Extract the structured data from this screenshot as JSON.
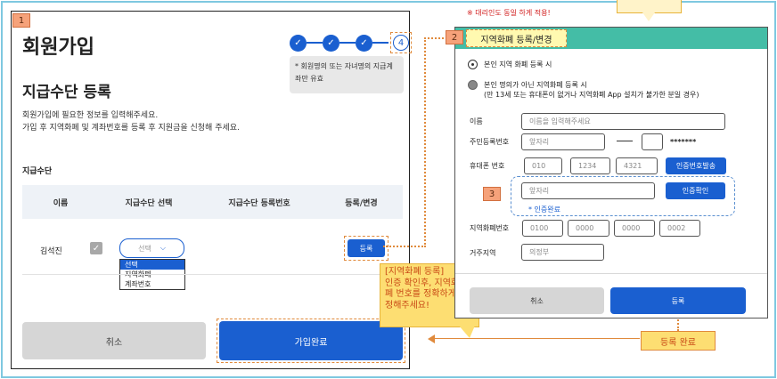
{
  "step_badges": {
    "left": "1",
    "right": "2",
    "verify": "3"
  },
  "left_panel": {
    "title": "회원가입",
    "steps": [
      "✓",
      "✓",
      "✓",
      "4"
    ],
    "notice": "* 회원명의 또는 자녀명의 지급계좌만 유효",
    "subtitle": "지급수단 등록",
    "desc_line1": "회원가입에 필요한 정보를 입력해주세요.",
    "desc_line2": "가입 후 지역화폐 및 계좌번호를 등록 후 지원금을 신청해 주세요.",
    "section_label": "지급수단",
    "table_headers": [
      "이름",
      "지급수단 선택",
      "지급수단 등록번호",
      "등록/변경"
    ],
    "row": {
      "name": "김석진",
      "checkbox_mark": "✓",
      "select_value": "선택",
      "select_arrow": "⌵",
      "dropdown_options": [
        "선택",
        "지역화폐",
        "계좌번호"
      ],
      "register_button": "등록"
    },
    "cancel_button": "취소",
    "join_button": "가입완료"
  },
  "callout": {
    "line1": "[지역화폐 등록]",
    "line2": "인증 확인후, 지역화",
    "line3": "폐 번호를 정확하게",
    "line4": "정해주세요!"
  },
  "right_panel": {
    "top_note": "※ 대리인도 동일 하게 적용!",
    "header_title": "지역화폐 등록/변경",
    "radio1_label": "본인 지역 화폐 등록 시",
    "radio2_label_line1": "본인 명의가 아닌 지역화폐 등록 시",
    "radio2_label_line2": "(만 13세 또는 휴대폰이 없거나 지역화폐 App 설치가 불가한 분일 경우)",
    "name_label": "이름",
    "name_placeholder": "이름을 입력해주세요",
    "rrn_label": "주민등록번호",
    "rrn_placeholder": "앞자리",
    "rrn_masked": "*******",
    "phone_label": "휴대폰 번호",
    "phone_parts": [
      "010",
      "1234",
      "4321"
    ],
    "send_code_button": "인증번호발송",
    "verify_placeholder": "앞자리",
    "verify_button": "인증확인",
    "verify_done": "* 인증완료",
    "currency_label": "지역화폐번호",
    "currency_parts": [
      "0100",
      "0000",
      "0000",
      "0002"
    ],
    "region_label": "거주지역",
    "region_value": "의정부",
    "cancel_button": "취소",
    "register_button": "등록"
  },
  "done_label": "등록 완료"
}
